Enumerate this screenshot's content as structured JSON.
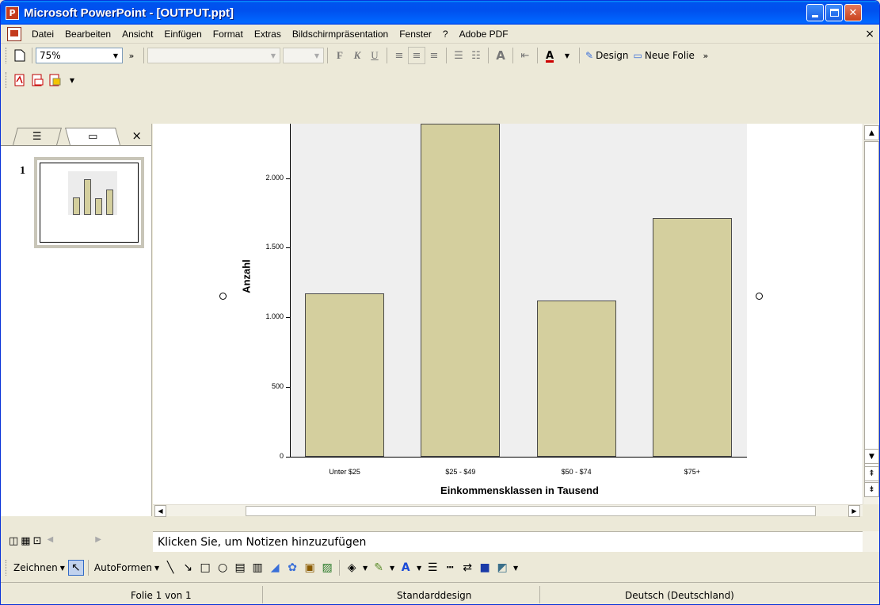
{
  "window": {
    "title": "Microsoft PowerPoint - [OUTPUT.ppt]",
    "app_icon": "powerpoint-icon"
  },
  "menubar": {
    "items": [
      "Datei",
      "Bearbeiten",
      "Ansicht",
      "Einfügen",
      "Format",
      "Extras",
      "Bildschirmpräsentation",
      "Fenster",
      "?",
      "Adobe PDF"
    ],
    "close_glyph": "×"
  },
  "toolbar": {
    "zoom": "75%",
    "more": "»",
    "font_bold": "F",
    "font_italic": "K",
    "font_underline": "U",
    "design_label": "Design",
    "new_slide_label": "Neue Folie"
  },
  "slide_pane": {
    "slide_number": "1",
    "close_glyph": "×"
  },
  "chart_data": {
    "type": "bar",
    "categories": [
      "Unter $25",
      "$25 - $49",
      "$50 - $74",
      "$75+"
    ],
    "values": [
      1175,
      2390,
      1120,
      1715
    ],
    "xlabel": "Einkommensklassen in Tausend",
    "ylabel": "Anzahl",
    "yticks": [
      0,
      500,
      1000,
      1500,
      2000
    ],
    "ytick_labels": [
      "0",
      "500",
      "1.000",
      "1.500",
      "2.000"
    ],
    "ylim": [
      0,
      2390
    ],
    "bar_color": "#d4cf9e",
    "background": "#efefef"
  },
  "notes": {
    "placeholder": "Klicken Sie, um Notizen hinzuzufügen"
  },
  "drawbar": {
    "draw_label": "Zeichnen",
    "autoshapes_label": "AutoFormen"
  },
  "statusbar": {
    "slide_info": "Folie 1 von 1",
    "design": "Standarddesign",
    "language": "Deutsch (Deutschland)"
  }
}
